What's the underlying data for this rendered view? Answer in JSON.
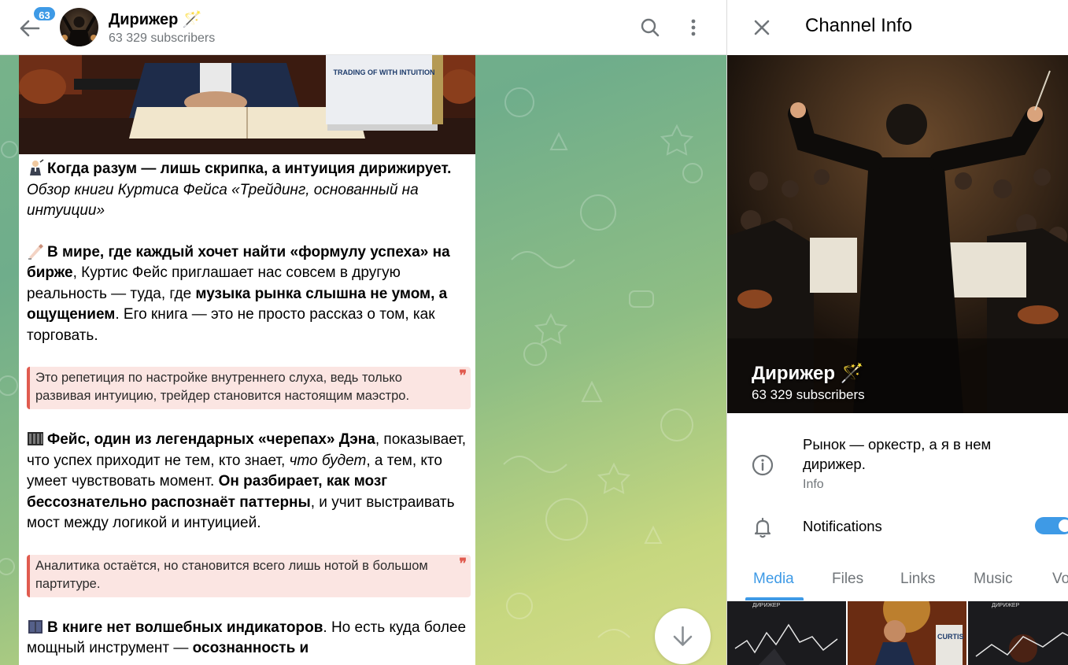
{
  "chat": {
    "unread_count": "63",
    "title": "Дирижер 🪄",
    "subtitle": "63 329 subscribers",
    "post": {
      "photo_book_title": "INUITION",
      "photo_book_subtitle": "TRADING OF WITH INTUITION",
      "p1_bold": "Когда разум — лишь скрипка, а интуиция дирижирует.",
      "p1_italic": "Обзор книги Куртиса Фейса «Трейдинг, основанный на интуиции»",
      "p2_b1": "В мире, где каждый хочет найти «формулу успеха» на бирже",
      "p2_t1": ", Куртис Фейс приглашает нас совсем в другую реальность — туда, где ",
      "p2_b2": "музыка рынка слышна не умом, а ощущением",
      "p2_t2": ". Его книга — это не просто рассказ о том, как торговать.",
      "quote1": "Это репетиция по настройке внутреннего слуха, ведь только развивая интуицию, трейдер становится настоящим маэстро.",
      "p3_b1": "Фейс, один из легендарных «черепах» Дэна",
      "p3_t1": ", показывает, что успех приходит не тем, кто знает, ",
      "p3_i1": "что будет",
      "p3_t2": ", а тем, кто умеет чувствовать момент. ",
      "p3_b2": "Он разбирает, как мозг бессознательно распознаёт паттерны",
      "p3_t3": ", и учит выстраивать мост между логикой и интуицией.",
      "quote2": "Аналитика остаётся, но становится всего лишь нотой в большом партитуре.",
      "p4_b1": "В книге нет волшебных индикаторов",
      "p4_t1": ". Но есть куда более мощный инструмент — ",
      "p4_b2": "осознанность и",
      "quote_mark": "❞"
    }
  },
  "info": {
    "title": "Channel Info",
    "channel_name": "Дирижер 🪄",
    "subscribers": "63 329 subscribers",
    "about": "Рынок — оркестр, а я в нем дирижер.",
    "about_label": "Info",
    "notifications_label": "Notifications",
    "notifications_on": true,
    "tabs": [
      "Media",
      "Files",
      "Links",
      "Music",
      "Vo"
    ],
    "active_tab": "Media",
    "thumb_labels": [
      "ДИРИЖЕР",
      "CURTIS",
      "ДИРИЖЕР"
    ]
  },
  "colors": {
    "accent": "#3e9ae6",
    "quote_bar": "#e05b4f",
    "quote_bg": "#fbe5e2",
    "chat_bg_top": "#79b48a",
    "chat_bg_bottom": "#d6dc88"
  }
}
